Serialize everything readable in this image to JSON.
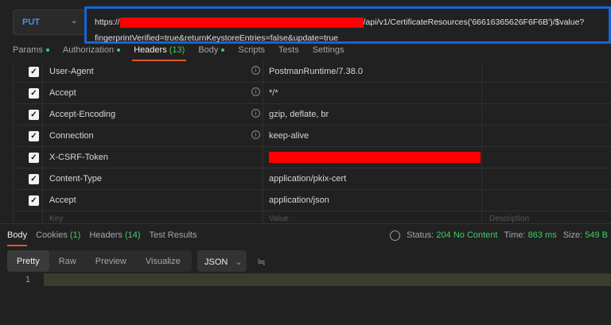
{
  "request": {
    "method": "PUT",
    "url_prefix": "https://",
    "url_suffix": "/api/v1/CertificateResources('66616365626F6F6B')/$value?",
    "url_query": "fingerprintVerified=true&returnKeystoreEntries=false&update=true"
  },
  "tabs": [
    {
      "label": "Params",
      "dot": true
    },
    {
      "label": "Authorization",
      "dot": true
    },
    {
      "label": "Headers",
      "count": "(13)"
    },
    {
      "label": "Body",
      "dot": true
    },
    {
      "label": "Scripts"
    },
    {
      "label": "Tests"
    },
    {
      "label": "Settings"
    }
  ],
  "headers": [
    {
      "key": "User-Agent",
      "value": "PostmanRuntime/7.38.0",
      "info": true
    },
    {
      "key": "Accept",
      "value": "*/*",
      "info": true
    },
    {
      "key": "Accept-Encoding",
      "value": "gzip, deflate, br",
      "info": true
    },
    {
      "key": "Connection",
      "value": "keep-alive",
      "info": true
    },
    {
      "key": "X-CSRF-Token",
      "value": "",
      "redacted": true
    },
    {
      "key": "Content-Type",
      "value": "application/pkix-cert"
    },
    {
      "key": "Accept",
      "value": "application/json"
    }
  ],
  "placeholders": {
    "key": "Key",
    "value": "Value",
    "description": "Description"
  },
  "response": {
    "tabs": [
      {
        "label": "Body"
      },
      {
        "label": "Cookies",
        "count": "(1)"
      },
      {
        "label": "Headers",
        "count": "(14)"
      },
      {
        "label": "Test Results"
      }
    ],
    "status_label": "Status:",
    "status": "204 No Content",
    "time_label": "Time:",
    "time": "863 ms",
    "size_label": "Size:",
    "size": "549 B",
    "views": [
      "Pretty",
      "Raw",
      "Preview",
      "Visualize"
    ],
    "format": "JSON",
    "line_number": "1"
  },
  "colors": {
    "accent": "#e0582c",
    "green": "#3ccf63",
    "url_border": "#1565d8",
    "method": "#4f8fe0"
  }
}
